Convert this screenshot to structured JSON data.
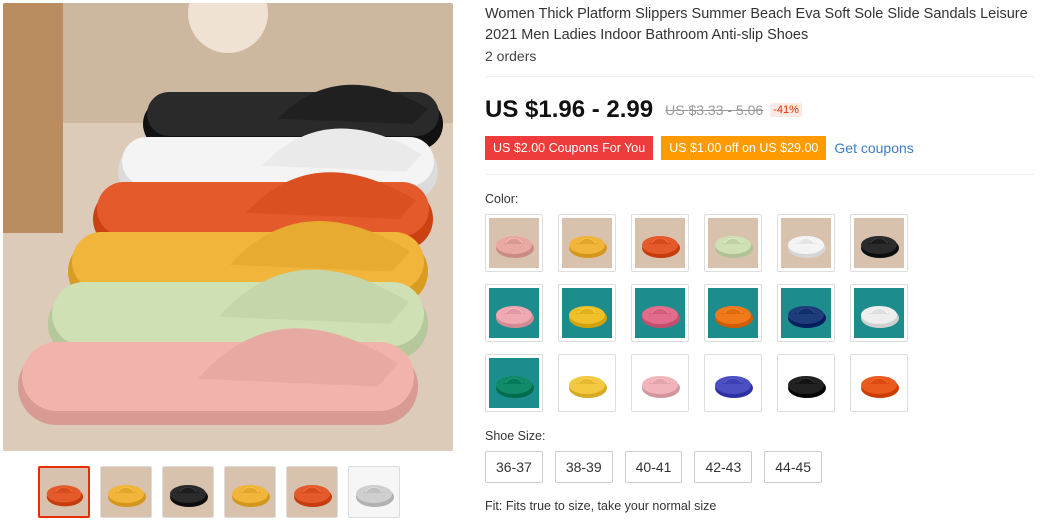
{
  "product": {
    "title": "Women Thick Platform Slippers Summer Beach Eva Soft Sole Slide Sandals Leisure 2021 Men Ladies Indoor Bathroom Anti-slip Shoes",
    "orders": "2 orders",
    "price": "US $1.96 - 2.99",
    "original_price": "US $3.33 - 5.06",
    "discount": "-41%"
  },
  "coupons": {
    "coupon1": "US $2.00 Coupons For You",
    "coupon2": "US $1.00 off on US $29.00",
    "get_label": "Get coupons"
  },
  "colors": {
    "label": "Color:",
    "swatches": [
      {
        "icon": "pink-slipper",
        "color": "#e9a9a3",
        "bg": "#d9c2ad"
      },
      {
        "icon": "yellow-slipper",
        "color": "#f0b53a",
        "bg": "#d9c2ad"
      },
      {
        "icon": "orange-slipper",
        "color": "#e45a2b",
        "bg": "#d9c2ad"
      },
      {
        "icon": "green-slipper",
        "color": "#cfe0b4",
        "bg": "#d9c2ad"
      },
      {
        "icon": "white-slipper",
        "color": "#f4f4f4",
        "bg": "#d9c2ad"
      },
      {
        "icon": "black-slipper",
        "color": "#2b2b2b",
        "bg": "#d9c2ad"
      },
      {
        "icon": "pink-slipper-teal",
        "color": "#f0a9b2",
        "bg": "#1c8c8c"
      },
      {
        "icon": "yellow-slipper-teal",
        "color": "#f0c02a",
        "bg": "#1c8c8c"
      },
      {
        "icon": "rose-slipper-teal",
        "color": "#e26c8c",
        "bg": "#1c8c8c"
      },
      {
        "icon": "orange-slipper-teal",
        "color": "#f07a1a",
        "bg": "#1c8c8c"
      },
      {
        "icon": "navy-slipper-teal",
        "color": "#1f3c7a",
        "bg": "#1c8c8c"
      },
      {
        "icon": "white-slipper-teal",
        "color": "#eeeeee",
        "bg": "#1c8c8c"
      },
      {
        "icon": "green-slipper-teal",
        "color": "#118a6a",
        "bg": "#1c8c8c"
      },
      {
        "icon": "yellow-slipper-white",
        "color": "#f5c842",
        "bg": "#ffffff"
      },
      {
        "icon": "pink-slipper-white",
        "color": "#f2b4bb",
        "bg": "#ffffff"
      },
      {
        "icon": "blue-slipper-white",
        "color": "#4b4fc2",
        "bg": "#ffffff"
      },
      {
        "icon": "black-slipper-white",
        "color": "#222222",
        "bg": "#ffffff"
      },
      {
        "icon": "orange-slipper-white",
        "color": "#ea5a1f",
        "bg": "#ffffff"
      }
    ]
  },
  "sizes": {
    "label": "Shoe Size:",
    "options": [
      "36-37",
      "38-39",
      "40-41",
      "42-43",
      "44-45"
    ],
    "fit_note": "Fit: Fits true to size, take your normal size"
  },
  "gallery": {
    "main_colors": [
      "#2a2a2a",
      "#f4f4f4",
      "#e45a2b",
      "#f0b53a",
      "#cfe0b4",
      "#f0b4ad"
    ],
    "thumbnails": [
      {
        "icon": "slipper-stack-thumb",
        "color": "#e45a2b"
      },
      {
        "icon": "slipper-row-thumb",
        "color": "#f0b53a"
      },
      {
        "icon": "black-slipper-thumb",
        "color": "#2b2b2b"
      },
      {
        "icon": "slipper-mix-thumb",
        "color": "#f0b53a"
      },
      {
        "icon": "orange-slipper-thumb",
        "color": "#e45a2b"
      },
      {
        "icon": "size-chart-thumb",
        "color": "#cfcfcf"
      }
    ]
  },
  "theme": {
    "accent": "#e62e04",
    "coupon_red": "#ee3b3b",
    "coupon_orange": "#ff9a00",
    "link": "#3c7cc4"
  }
}
